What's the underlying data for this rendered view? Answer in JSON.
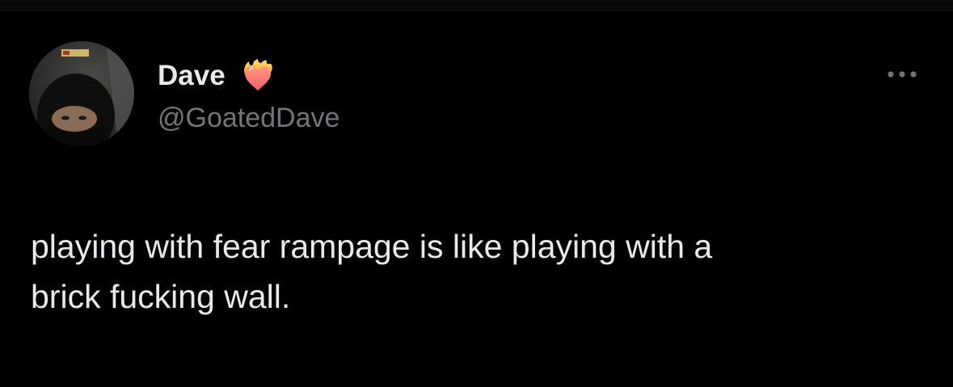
{
  "user": {
    "display_name": "Dave",
    "handle": "@GoatedDave",
    "badge_icon": "heart-on-fire-icon",
    "avatar_icon": "profile-avatar"
  },
  "tweet": {
    "text": "playing with fear rampage is like playing with a\nbrick fucking wall."
  },
  "actions": {
    "more_icon": "more-options-icon"
  },
  "colors": {
    "background": "#000000",
    "primary_text": "#e7e9ea",
    "secondary_text": "#71767b"
  }
}
